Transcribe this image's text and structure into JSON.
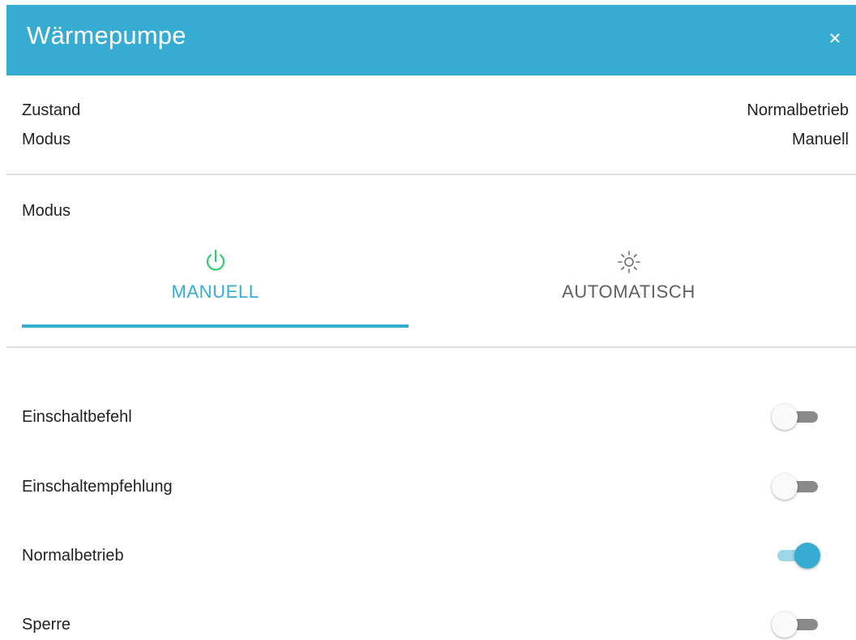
{
  "header": {
    "title": "Wärmepumpe",
    "close_label": "×",
    "background_color": "#36acd2"
  },
  "status": {
    "rows": [
      {
        "label": "Zustand",
        "value": "Normalbetrieb"
      },
      {
        "label": "Modus",
        "value": "Manuell"
      }
    ]
  },
  "mode_section": {
    "label": "Modus",
    "tabs": [
      {
        "label": "MANUELL",
        "icon": "power-icon",
        "icon_color": "#2ecc71",
        "active": true
      },
      {
        "label": "AUTOMATISCH",
        "icon": "sun-icon",
        "active": false
      }
    ]
  },
  "switches": [
    {
      "label": "Einschaltbefehl",
      "on": false
    },
    {
      "label": "Einschaltempfehlung",
      "on": false
    },
    {
      "label": "Normalbetrieb",
      "on": true
    },
    {
      "label": "Sperre",
      "on": false
    }
  ],
  "colors": {
    "accent": "#36acd2",
    "power_icon": "#2ecc71",
    "toggle_on_track": "#9bd6ea",
    "toggle_off_track": "#8a8a8a"
  }
}
